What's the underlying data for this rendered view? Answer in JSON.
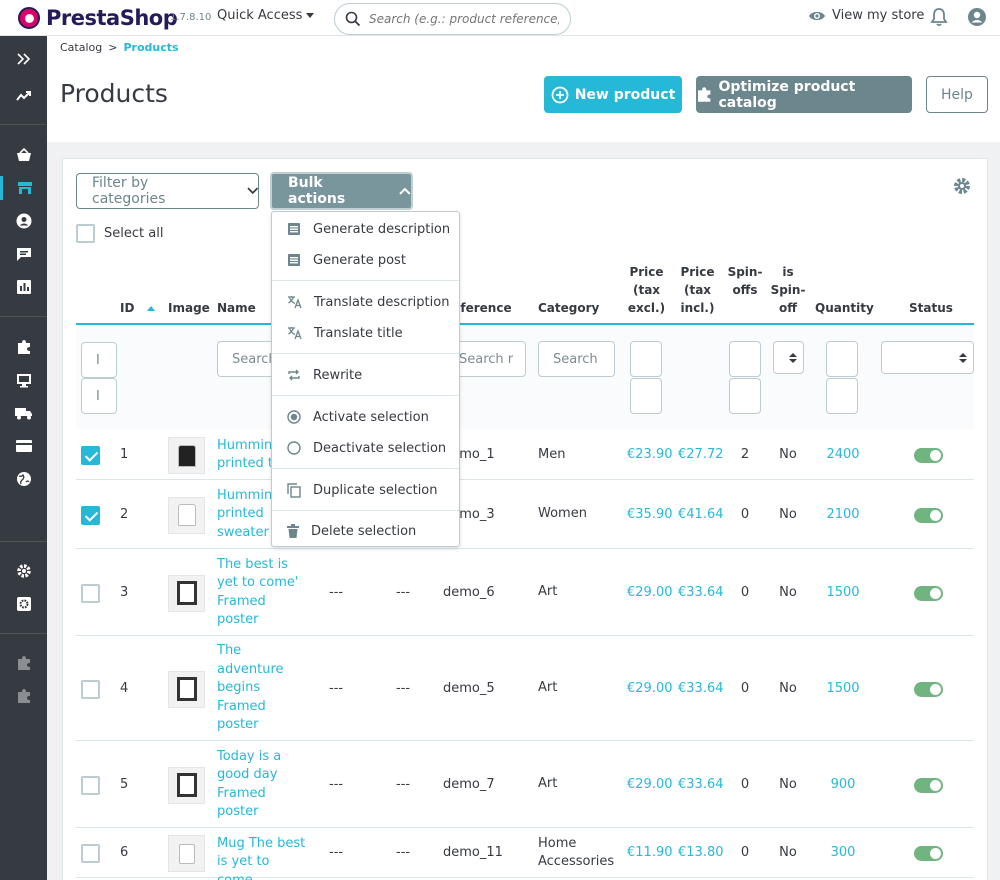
{
  "header": {
    "brand": "PrestaShop",
    "version": "1.7.8.10",
    "quick_access": "Quick Access",
    "search_placeholder": "Search (e.g.: product reference, custon",
    "view_store": "View my store"
  },
  "breadcrumb": {
    "parent": "Catalog",
    "sep": ">",
    "current": "Products"
  },
  "page": {
    "title": "Products",
    "new_product": "New product",
    "optimize": "Optimize product catalog",
    "help": "Help"
  },
  "toolbar": {
    "filter_categories": "Filter by categories",
    "bulk_actions": "Bulk actions",
    "select_all": "Select all"
  },
  "bulk_menu": [
    {
      "label": "Generate description",
      "icon": "document-icon"
    },
    {
      "label": "Generate post",
      "icon": "document-icon"
    },
    {
      "label": "Translate description",
      "icon": "translate-icon"
    },
    {
      "label": "Translate title",
      "icon": "translate-icon"
    },
    {
      "label": "Rewrite",
      "icon": "repeat-icon"
    },
    {
      "label": "Activate selection",
      "icon": "radio-checked-icon"
    },
    {
      "label": "Deactivate selection",
      "icon": "radio-unchecked-icon"
    },
    {
      "label": "Duplicate selection",
      "icon": "copy-icon"
    },
    {
      "label": "Delete selection",
      "icon": "trash-icon"
    }
  ],
  "table": {
    "headers": {
      "id": "ID",
      "image": "Image",
      "name": "Name",
      "reference": "Reference",
      "category": "Category",
      "price_excl": [
        "Price",
        "(tax",
        "excl.)"
      ],
      "price_incl": [
        "Price",
        "(tax",
        "incl.)"
      ],
      "spinoffs": [
        "Spin-",
        "offs"
      ],
      "is_spinoff": [
        "is",
        "Spin-",
        "off"
      ],
      "quantity": "Quantity",
      "status": "Status"
    },
    "filters": {
      "id_min": "I",
      "id_max": "I",
      "name": "Search",
      "reference": "Search r",
      "category": "Search"
    },
    "rows": [
      {
        "checked": true,
        "id": "1",
        "name": [
          "Humming",
          "printed t-"
        ],
        "col_a": "",
        "col_b": "",
        "reference": "demo_1",
        "category": [
          "Men"
        ],
        "price_excl": "€23.90",
        "price_incl": "€27.72",
        "spinoffs": "2",
        "is_spinoff": "No",
        "quantity": "2400",
        "active": true
      },
      {
        "checked": true,
        "id": "2",
        "name": [
          "Humming",
          "printed",
          "sweater"
        ],
        "col_a": "",
        "col_b": "",
        "reference": "demo_3",
        "category": [
          "Women"
        ],
        "price_excl": "€35.90",
        "price_incl": "€41.64",
        "spinoffs": "0",
        "is_spinoff": "No",
        "quantity": "2100",
        "active": true
      },
      {
        "checked": false,
        "id": "3",
        "name": [
          "The best is",
          "yet to come'",
          "Framed",
          "poster"
        ],
        "col_a": "---",
        "col_b": "---",
        "reference": "demo_6",
        "category": [
          "Art"
        ],
        "price_excl": "€29.00",
        "price_incl": "€33.64",
        "spinoffs": "0",
        "is_spinoff": "No",
        "quantity": "1500",
        "active": true
      },
      {
        "checked": false,
        "id": "4",
        "name": [
          "The",
          "adventure",
          "begins",
          "Framed",
          "poster"
        ],
        "col_a": "---",
        "col_b": "---",
        "reference": "demo_5",
        "category": [
          "Art"
        ],
        "price_excl": "€29.00",
        "price_incl": "€33.64",
        "spinoffs": "0",
        "is_spinoff": "No",
        "quantity": "1500",
        "active": true
      },
      {
        "checked": false,
        "id": "5",
        "name": [
          "Today is a",
          "good day",
          "Framed",
          "poster"
        ],
        "col_a": "---",
        "col_b": "---",
        "reference": "demo_7",
        "category": [
          "Art"
        ],
        "price_excl": "€29.00",
        "price_incl": "€33.64",
        "spinoffs": "0",
        "is_spinoff": "No",
        "quantity": "900",
        "active": true
      },
      {
        "checked": false,
        "id": "6",
        "name": [
          "Mug The best",
          "is yet to come"
        ],
        "col_a": "---",
        "col_b": "---",
        "reference": "demo_11",
        "category": [
          "Home",
          "Accessories"
        ],
        "price_excl": "€11.90",
        "price_incl": "€13.80",
        "spinoffs": "0",
        "is_spinoff": "No",
        "quantity": "300",
        "active": true
      }
    ]
  },
  "colors": {
    "accent": "#25b9d7",
    "sidebar": "#363a41",
    "toggle_on": "#70b580",
    "secondary": "#6c868e"
  }
}
